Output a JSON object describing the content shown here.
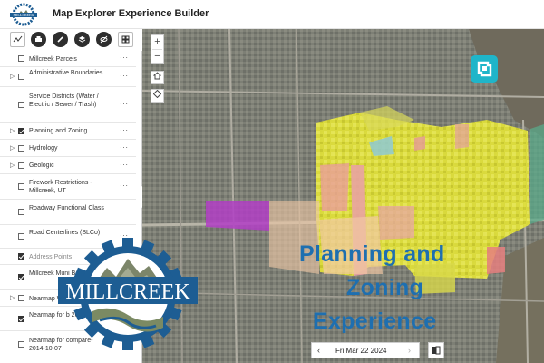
{
  "app": {
    "title": "Map Explorer Experience Builder",
    "logo_text": "MILLCREEK"
  },
  "toolbar": {
    "tools": [
      "chart-icon",
      "print-icon",
      "draw-icon",
      "layers-icon",
      "visibility-icon",
      "grid-icon"
    ]
  },
  "layers": [
    {
      "label": "Millcreek Parcels",
      "checked": false,
      "expandable": false,
      "dimmed": false
    },
    {
      "label": "Administrative Boundaries",
      "checked": false,
      "expandable": true,
      "dimmed": false
    },
    {
      "label": "Service Districts (Water / Electric / Sewer / Trash)",
      "checked": false,
      "expandable": false,
      "dimmed": false
    },
    {
      "label": "Planning and Zoning",
      "checked": true,
      "expandable": true,
      "dimmed": false
    },
    {
      "label": "Hydrology",
      "checked": false,
      "expandable": true,
      "dimmed": false
    },
    {
      "label": "Geologic",
      "checked": false,
      "expandable": true,
      "dimmed": false
    },
    {
      "label": "Firework Restrictions - Millcreek, UT",
      "checked": false,
      "expandable": false,
      "dimmed": false
    },
    {
      "label": "Roadway Functional Class",
      "checked": false,
      "expandable": false,
      "dimmed": false
    },
    {
      "label": "Road Centerlines (SLCo)",
      "checked": false,
      "expandable": false,
      "dimmed": false
    },
    {
      "label": "Address Points",
      "checked": true,
      "expandable": false,
      "dimmed": true
    },
    {
      "label": "Millcreek Muni Boundary",
      "checked": true,
      "expandable": false,
      "dimmed": false
    },
    {
      "label": "Nearmap W",
      "checked": false,
      "expandable": true,
      "dimmed": false
    },
    {
      "label": "Nearmap for b 2024-03-22",
      "checked": true,
      "expandable": false,
      "dimmed": false
    },
    {
      "label": "Nearmap for compare- 2014-10-07",
      "checked": false,
      "expandable": false,
      "dimmed": false
    }
  ],
  "map": {
    "zoom_in": "+",
    "zoom_out": "−",
    "overlay_lines": [
      "Planning and",
      "Zoning",
      "Experience"
    ],
    "overlay_color": "#1e6fb0",
    "zoning_color": "#e7e63a",
    "date_label": "Fri Mar 22 2024",
    "date_prev": "‹",
    "date_next": "›"
  },
  "badge": {
    "text": "MILLCREEK",
    "ring_color": "#1d5d93"
  },
  "more_label": "···",
  "collapse_label": "‹"
}
